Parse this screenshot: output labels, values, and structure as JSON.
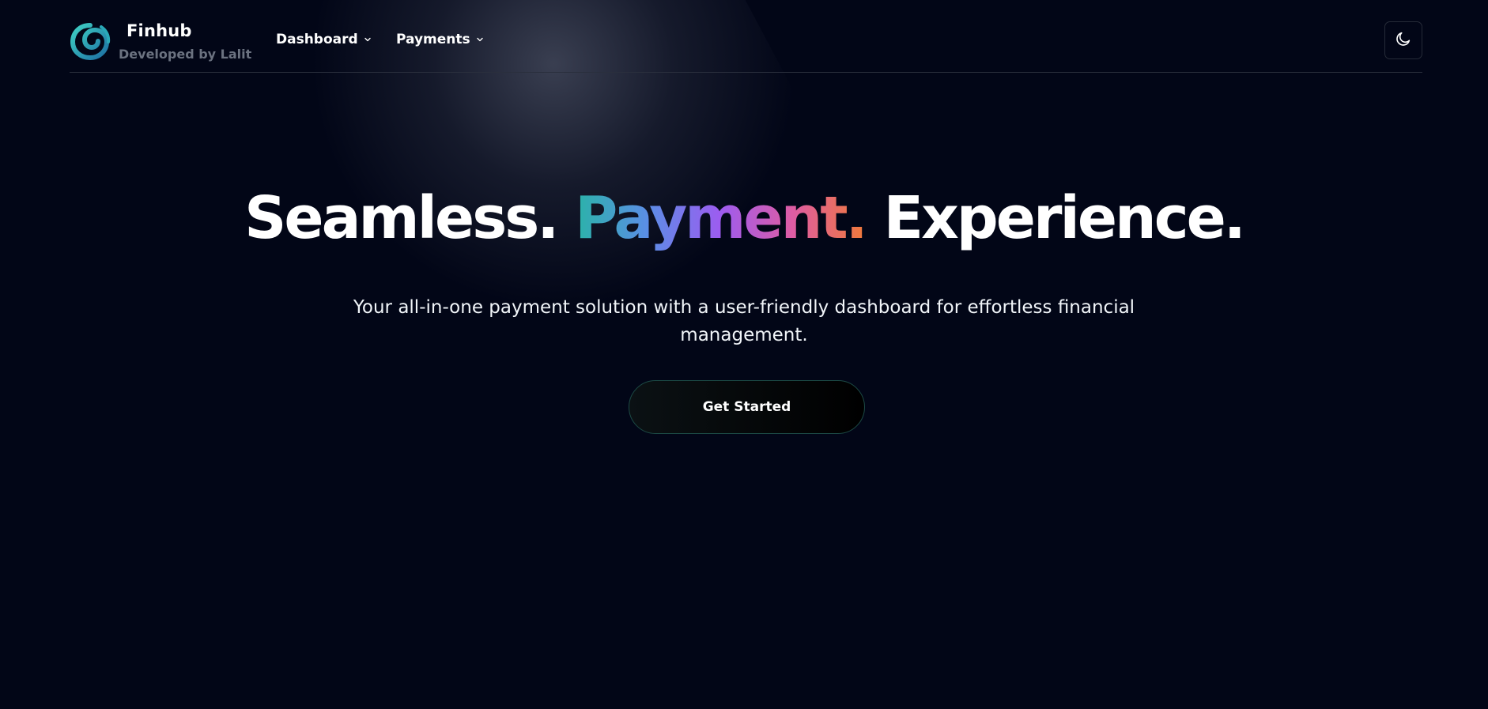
{
  "brand": {
    "name": "Finhub",
    "tagline": "Developed by Lalit",
    "logo_icon": "swirl-logo-icon"
  },
  "nav": {
    "items": [
      {
        "label": "Dashboard",
        "icon": "chevron-down-icon"
      },
      {
        "label": "Payments",
        "icon": "chevron-down-icon"
      }
    ],
    "theme_toggle_icon": "moon-icon"
  },
  "hero": {
    "title_part1": "Seamless. ",
    "title_highlight": "Payment.",
    "title_part3": " Experience.",
    "subtitle": "Your all-in-one payment solution with a user-friendly dashboard for effortless financial management.",
    "cta_label": "Get Started"
  },
  "colors": {
    "background": "#020617",
    "gradient": [
      "#2ab3a8",
      "#5b8ee6",
      "#9d5cf0",
      "#de5ca3",
      "#f07a3a"
    ],
    "muted_text": "#6b7280"
  }
}
